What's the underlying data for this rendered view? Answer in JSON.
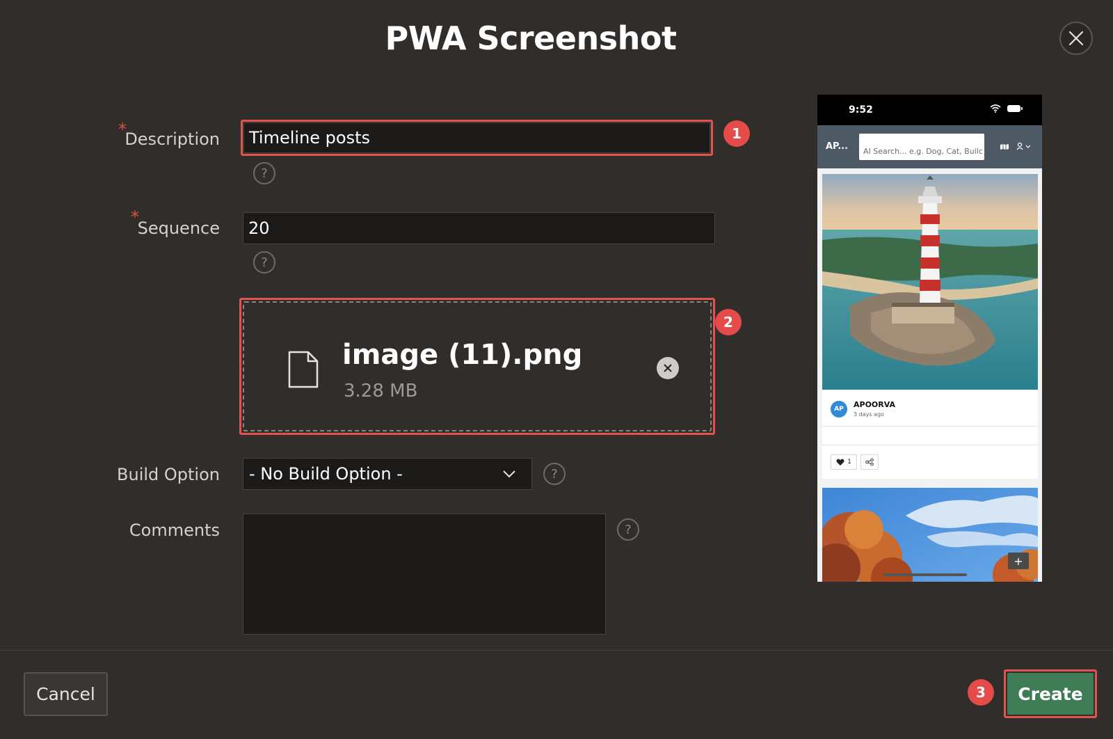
{
  "dialog": {
    "title": "PWA Screenshot"
  },
  "form": {
    "description": {
      "label": "Description",
      "value": "Timeline posts",
      "required": true
    },
    "sequence": {
      "label": "Sequence",
      "value": "20",
      "required": true
    },
    "file": {
      "name": "image (11).png",
      "size": "3.28 MB"
    },
    "build_option": {
      "label": "Build Option",
      "selected": "- No Build Option -"
    },
    "comments": {
      "label": "Comments",
      "value": ""
    },
    "help_glyph": "?",
    "required_glyph": "*"
  },
  "markers": [
    "1",
    "2",
    "3"
  ],
  "buttons": {
    "cancel": "Cancel",
    "create": "Create"
  },
  "preview": {
    "status_time": "9:52",
    "app_short": "AP...",
    "search_placeholder": "AI Search... e.g. Dog, Cat, Builc",
    "post": {
      "avatar": "AP",
      "user": "APOORVA",
      "time": "3 days ago",
      "likes": "1"
    },
    "add_glyph": "+"
  },
  "colors": {
    "background": "#312d2a",
    "input_bg": "#1b1a19",
    "highlight": "#e2544e",
    "marker": "#e54b48",
    "create_button": "#3f7b55",
    "avatar": "#2f8bd6"
  },
  "icons": [
    "close-icon",
    "help-icon",
    "file-icon",
    "remove-file-icon",
    "chevron-down-icon",
    "map-icon",
    "user-icon",
    "heart-icon",
    "share-icon",
    "wifi-icon",
    "battery-icon"
  ]
}
